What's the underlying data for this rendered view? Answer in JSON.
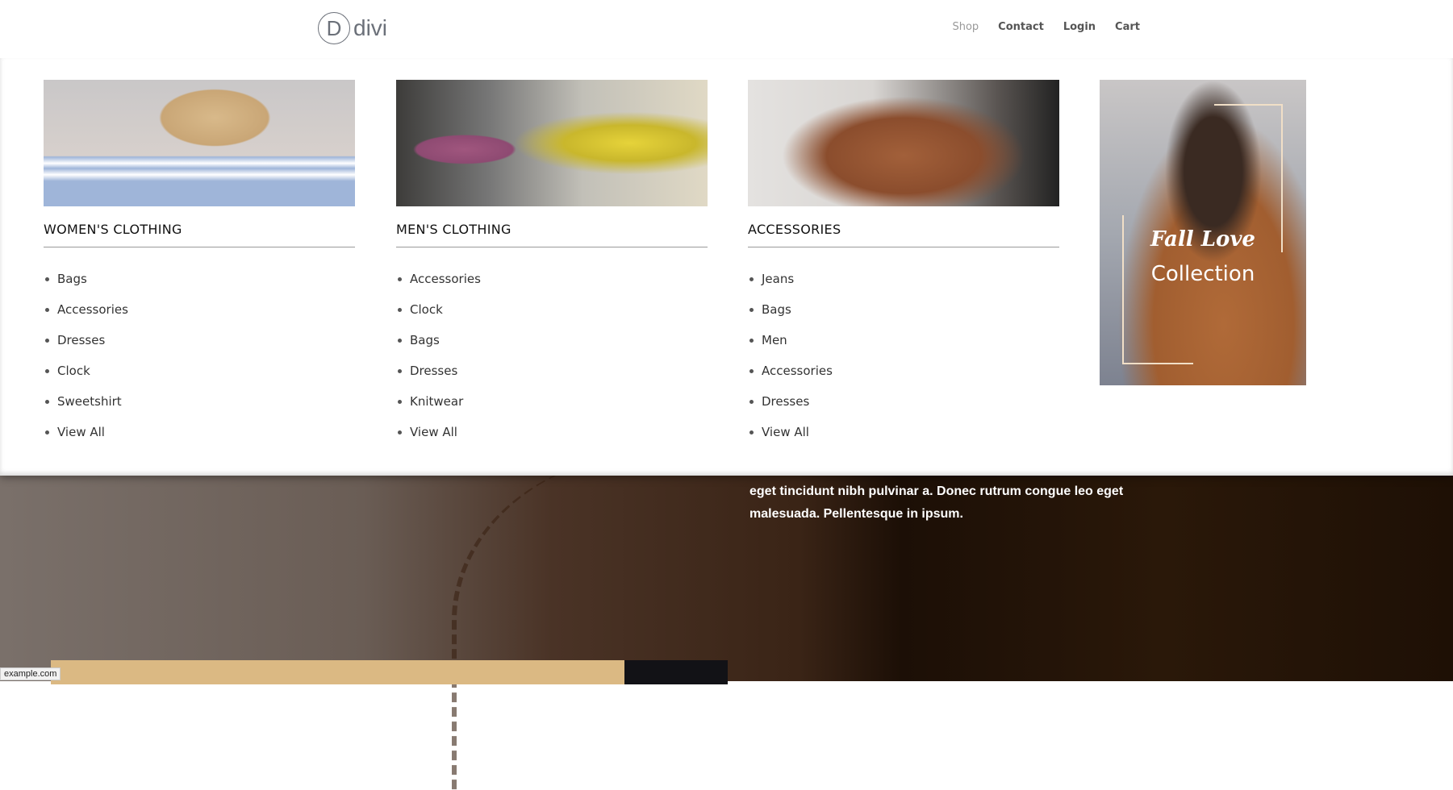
{
  "header": {
    "logo_letter": "D",
    "logo_text": "divi",
    "nav": [
      {
        "label": "Shop",
        "active": true
      },
      {
        "label": "Contact"
      },
      {
        "label": "Login"
      },
      {
        "label": "Cart"
      }
    ]
  },
  "mega_menu": {
    "columns": [
      {
        "title": "WOMEN'S CLOTHING",
        "items": [
          "Bags",
          "Accessories",
          "Dresses",
          "Clock",
          "Sweetshirt",
          "View All"
        ]
      },
      {
        "title": "MEN'S CLOTHING",
        "items": [
          "Accessories",
          "Clock",
          "Bags",
          "Dresses",
          "Knitwear",
          "View All"
        ]
      },
      {
        "title": "ACCESSORIES",
        "items": [
          "Jeans",
          "Bags",
          "Men",
          "Accessories",
          "Dresses",
          "View All"
        ]
      }
    ],
    "promo": {
      "line1": "Fall Love",
      "line2": "Collection"
    }
  },
  "hero": {
    "text_line1": "eget tincidunt nibh pulvinar a. Donec rutrum congue leo eget",
    "text_line2": "malesuada. Pellentesque in ipsum."
  },
  "status_bar": {
    "url": "example.com"
  },
  "colors": {
    "tan": "#dbb983",
    "dark": "#121216",
    "frame": "#f1dfc7"
  }
}
